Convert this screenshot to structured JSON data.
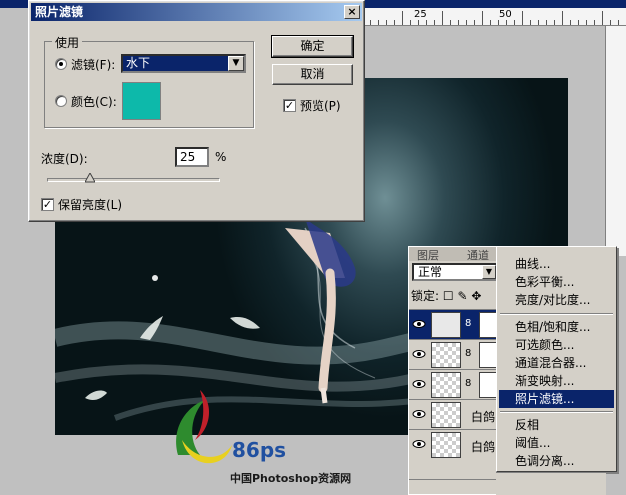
{
  "ruler": {
    "labels": [
      "25",
      "50"
    ]
  },
  "dialog": {
    "title": "照片滤镜",
    "close_label": "×",
    "use_group_label": "使用",
    "filter_radio_label": "滤镜(F):",
    "filter_value": "水下",
    "color_radio_label": "颜色(C):",
    "swatch_color": "#0db9aa",
    "ok_label": "确定",
    "cancel_label": "取消",
    "preview_label": "预览(P)",
    "preview_checked": true,
    "density_label": "浓度(D):",
    "density_value": "25",
    "density_unit": "%",
    "density_fraction": 0.25,
    "preserve_label": "保留亮度(L)",
    "preserve_checked": true
  },
  "layers": {
    "tabs": [
      "图层",
      "通道"
    ],
    "blend_mode": "正常",
    "lock_label": "锁定:",
    "rows": [
      {
        "name": "",
        "selected": true
      },
      {
        "name": "",
        "selected": false
      },
      {
        "name": "",
        "selected": false
      },
      {
        "name": "白鸽",
        "selected": false
      },
      {
        "name": "白鸽",
        "selected": false
      }
    ]
  },
  "menu": {
    "items": [
      {
        "label": "曲线...",
        "highlighted": false
      },
      {
        "label": "色彩平衡...",
        "highlighted": false
      },
      {
        "label": "亮度/对比度...",
        "highlighted": false
      },
      {
        "label": "色相/饱和度...",
        "highlighted": false
      },
      {
        "label": "可选颜色...",
        "highlighted": false
      },
      {
        "label": "通道混合器...",
        "highlighted": false
      },
      {
        "label": "渐变映射...",
        "highlighted": false
      },
      {
        "label": "照片滤镜...",
        "highlighted": true
      },
      {
        "label": "反相",
        "highlighted": false
      },
      {
        "label": "阈值...",
        "highlighted": false
      },
      {
        "label": "色调分离...",
        "highlighted": false
      }
    ]
  },
  "watermark": {
    "logo_text": "86ps",
    "caption": "中国Photoshop资源网"
  },
  "colors": {
    "titlebar": "#0a246a",
    "dialog_bg": "#d4d0c8",
    "highlight": "#0a246a"
  }
}
